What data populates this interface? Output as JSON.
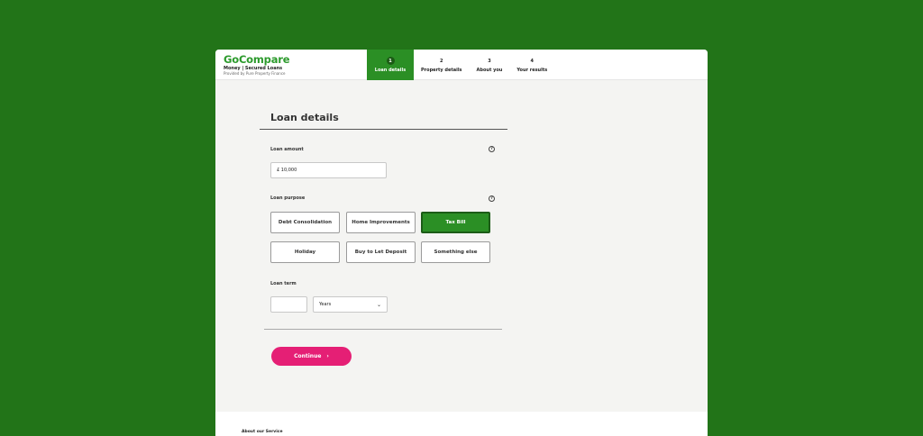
{
  "brand": {
    "logo": "GoCompare",
    "subtitle": "Money | Secured Loans",
    "provider": "Provided by Pure Property Finance"
  },
  "steps": [
    {
      "num": "1",
      "label": "Loan details",
      "active": true
    },
    {
      "num": "2",
      "label": "Property details",
      "active": false
    },
    {
      "num": "3",
      "label": "About you",
      "active": false
    },
    {
      "num": "4",
      "label": "Your results",
      "active": false
    }
  ],
  "form": {
    "title": "Loan details",
    "loan_amount": {
      "label": "Loan amount",
      "value": "£ 10,000",
      "help": "?"
    },
    "loan_purpose": {
      "label": "Loan purpose",
      "help": "?",
      "options": [
        {
          "label": "Debt Consolidation",
          "selected": false
        },
        {
          "label": "Home Improvements",
          "selected": false
        },
        {
          "label": "Tax Bill",
          "selected": true
        },
        {
          "label": "Holiday",
          "selected": false
        },
        {
          "label": "Buy to Let Deposit",
          "selected": false
        },
        {
          "label": "Something else",
          "selected": false
        }
      ]
    },
    "loan_term": {
      "label": "Loan term",
      "value": "",
      "unit": "Years"
    },
    "continue": {
      "label": "Continue",
      "icon": "chevron-right-icon"
    }
  },
  "footer": {
    "about": "About our Service"
  },
  "colors": {
    "background": "#227418",
    "accent": "#2b8f25",
    "cta": "#e51f75"
  }
}
